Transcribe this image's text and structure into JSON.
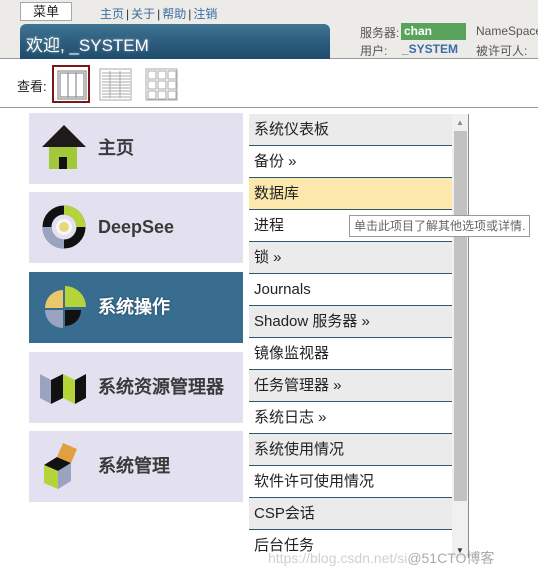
{
  "header": {
    "menu_label": "菜单",
    "links": [
      "主页",
      "关于",
      "帮助",
      "注销"
    ],
    "welcome": "欢迎, _SYSTEM",
    "server_label": "服务器:",
    "server_value": "chan",
    "namespace_label": "NameSpace",
    "user_label": "用户:",
    "user_value": "_SYSTEM",
    "licensee_label": "被许可人:"
  },
  "view": {
    "label": "查看:",
    "options": [
      "columns-view-icon",
      "list-view-icon",
      "grid-view-icon"
    ],
    "selected": 0
  },
  "categories": [
    {
      "label": "主页",
      "icon": "home-icon",
      "active": false
    },
    {
      "label": "DeepSee",
      "icon": "deepsee-icon",
      "active": false
    },
    {
      "label": "系统操作",
      "icon": "system-operation-icon",
      "active": true
    },
    {
      "label": "系统资源管理器",
      "icon": "system-explorer-icon",
      "active": false
    },
    {
      "label": "系统管理",
      "icon": "system-administration-icon",
      "active": false
    }
  ],
  "menu_items": [
    {
      "label": "系统仪表板"
    },
    {
      "label": "备份 »"
    },
    {
      "label": "数据库",
      "hover": true
    },
    {
      "label": "进程"
    },
    {
      "label": "锁 »"
    },
    {
      "label": "Journals"
    },
    {
      "label": "Shadow 服务器 »"
    },
    {
      "label": "镜像监视器"
    },
    {
      "label": "任务管理器 »"
    },
    {
      "label": "系统日志 »"
    },
    {
      "label": "系统使用情况"
    },
    {
      "label": "软件许可使用情况"
    },
    {
      "label": "CSP会话"
    },
    {
      "label": "后台任务"
    }
  ],
  "tooltip": "单击此项目了解其他选项或详情.",
  "watermark": {
    "url": "https://blog.csdn.net/si",
    "brand": "@51CTO博客"
  },
  "colors": {
    "active_category": "#386d8f",
    "category_bg": "#e3e1f0",
    "hover_item": "#fce8ac",
    "server_badge": "#5aa35c",
    "accent_link": "#3a6ea5"
  }
}
